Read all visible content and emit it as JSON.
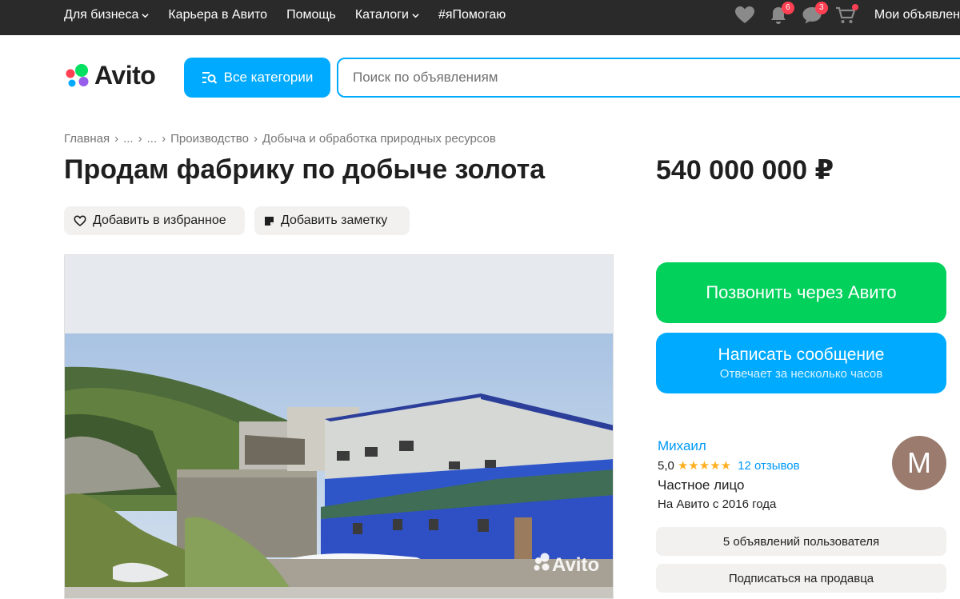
{
  "topnav": {
    "items": [
      {
        "label": "Для бизнеса",
        "dropdown": true
      },
      {
        "label": "Карьера в Авито",
        "dropdown": false
      },
      {
        "label": "Помощь",
        "dropdown": false
      },
      {
        "label": "Каталоги",
        "dropdown": true
      },
      {
        "label": "#яПомогаю",
        "dropdown": false
      }
    ],
    "notifications_count": "6",
    "messages_count": "3",
    "my_ads_label": "Мои объявлен"
  },
  "header": {
    "logo_text": "Avito",
    "categories_label": "Все категории",
    "search_placeholder": "Поиск по объявлениям"
  },
  "breadcrumb": [
    "Главная",
    "...",
    "...",
    "Производство",
    "Добыча и обработка природных ресурсов"
  ],
  "listing": {
    "title": "Продам фабрику по добыче золота",
    "price": "540 000 000 ₽",
    "add_favorite_label": "Добавить в избранное",
    "add_note_label": "Добавить заметку",
    "photo_watermark": "Avito"
  },
  "contact": {
    "call_label": "Позвонить через Авито",
    "message_label": "Написать сообщение",
    "message_sub": "Отвечает за несколько часов"
  },
  "seller": {
    "name": "Михаил",
    "rating": "5,0",
    "stars": "★★★★★",
    "reviews": "12 отзывов",
    "type": "Частное лицо",
    "since": "На Авито с 2016 года",
    "avatar_letter": "М",
    "ads_button": "5 объявлений пользователя",
    "subscribe_button": "Подписаться на продавца"
  },
  "colors": {
    "accent": "#00aaff",
    "call_green": "#02d15c",
    "badge_red": "#ff4053",
    "topbar": "#2a2a2a"
  }
}
